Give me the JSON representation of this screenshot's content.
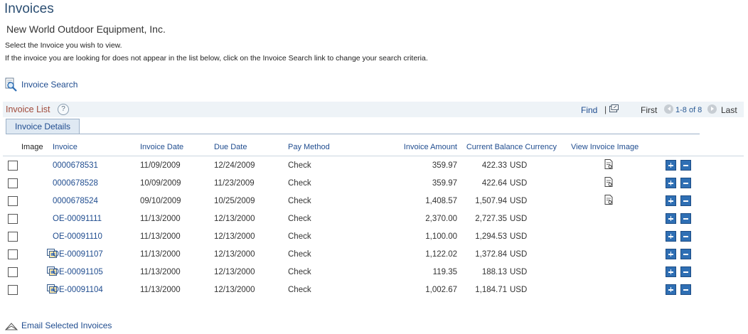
{
  "page": {
    "title": "Invoices",
    "company": "New World Outdoor Equipment, Inc.",
    "instruction_1": "Select the Invoice you wish to view.",
    "instruction_2": "If the invoice you are looking for does not appear in the list below, click on the Invoice Search link to change your search criteria.",
    "invoice_search_label": "Invoice Search"
  },
  "list": {
    "title": "Invoice List",
    "help": "?",
    "find": "Find",
    "separator": "|",
    "first": "First",
    "range": "1-8 of 8",
    "last": "Last",
    "tab": "Invoice Details"
  },
  "columns": [
    "Image",
    "Invoice",
    "Invoice Date",
    "Due Date",
    "Pay Method",
    "Invoice Amount",
    "Current Balance Currency",
    "View Invoice Image"
  ],
  "rows": [
    {
      "image": "",
      "invoice": "0000678531",
      "invoice_date": "11/09/2009",
      "due_date": "12/24/2009",
      "pay_method": "Check",
      "amount": "359.97",
      "balance": "422.33",
      "currency": "USD",
      "view": "view-invoice-image-icon"
    },
    {
      "image": "",
      "invoice": "0000678528",
      "invoice_date": "10/09/2009",
      "due_date": "11/23/2009",
      "pay_method": "Check",
      "amount": "359.97",
      "balance": "422.64",
      "currency": "USD",
      "view": "view-invoice-image-icon"
    },
    {
      "image": "",
      "invoice": "0000678524",
      "invoice_date": "09/10/2009",
      "due_date": "10/25/2009",
      "pay_method": "Check",
      "amount": "1,408.57",
      "balance": "1,507.94",
      "currency": "USD",
      "view": "view-invoice-image-icon"
    },
    {
      "image": "",
      "invoice": "OE-00091111",
      "invoice_date": "11/13/2000",
      "due_date": "12/13/2000",
      "pay_method": "Check",
      "amount": "2,370.00",
      "balance": "2,727.35",
      "currency": "USD",
      "view": ""
    },
    {
      "image": "",
      "invoice": "OE-00091110",
      "invoice_date": "11/13/2000",
      "due_date": "12/13/2000",
      "pay_method": "Check",
      "amount": "1,100.00",
      "balance": "1,294.53",
      "currency": "USD",
      "view": ""
    },
    {
      "image": "image-attachment-icon",
      "invoice": "OE-00091107",
      "invoice_date": "11/13/2000",
      "due_date": "12/13/2000",
      "pay_method": "Check",
      "amount": "1,122.02",
      "balance": "1,372.84",
      "currency": "USD",
      "view": ""
    },
    {
      "image": "image-attachment-icon",
      "invoice": "OE-00091105",
      "invoice_date": "11/13/2000",
      "due_date": "12/13/2000",
      "pay_method": "Check",
      "amount": "119.35",
      "balance": "188.13",
      "currency": "USD",
      "view": ""
    },
    {
      "image": "image-attachment-icon",
      "invoice": "OE-00091104",
      "invoice_date": "11/13/2000",
      "due_date": "12/13/2000",
      "pay_method": "Check",
      "amount": "1,002.67",
      "balance": "1,184.71",
      "currency": "USD",
      "view": ""
    }
  ],
  "email_label": "Email Selected Invoices",
  "icons": {
    "search": "magnifier-page-icon",
    "popout": "popout-window-icon",
    "prev": "nav-left-icon",
    "next": "nav-right-icon",
    "add_row": "plus-icon",
    "remove_row": "minus-icon",
    "email": "email-icon"
  },
  "colors": {
    "title": "#2b4e72",
    "link": "#1f4c8f",
    "list_title": "#a04a3a",
    "header_bar": "#eef3f7",
    "tab_bg": "#dfe9f3",
    "row_button": "#2f6fb4"
  }
}
